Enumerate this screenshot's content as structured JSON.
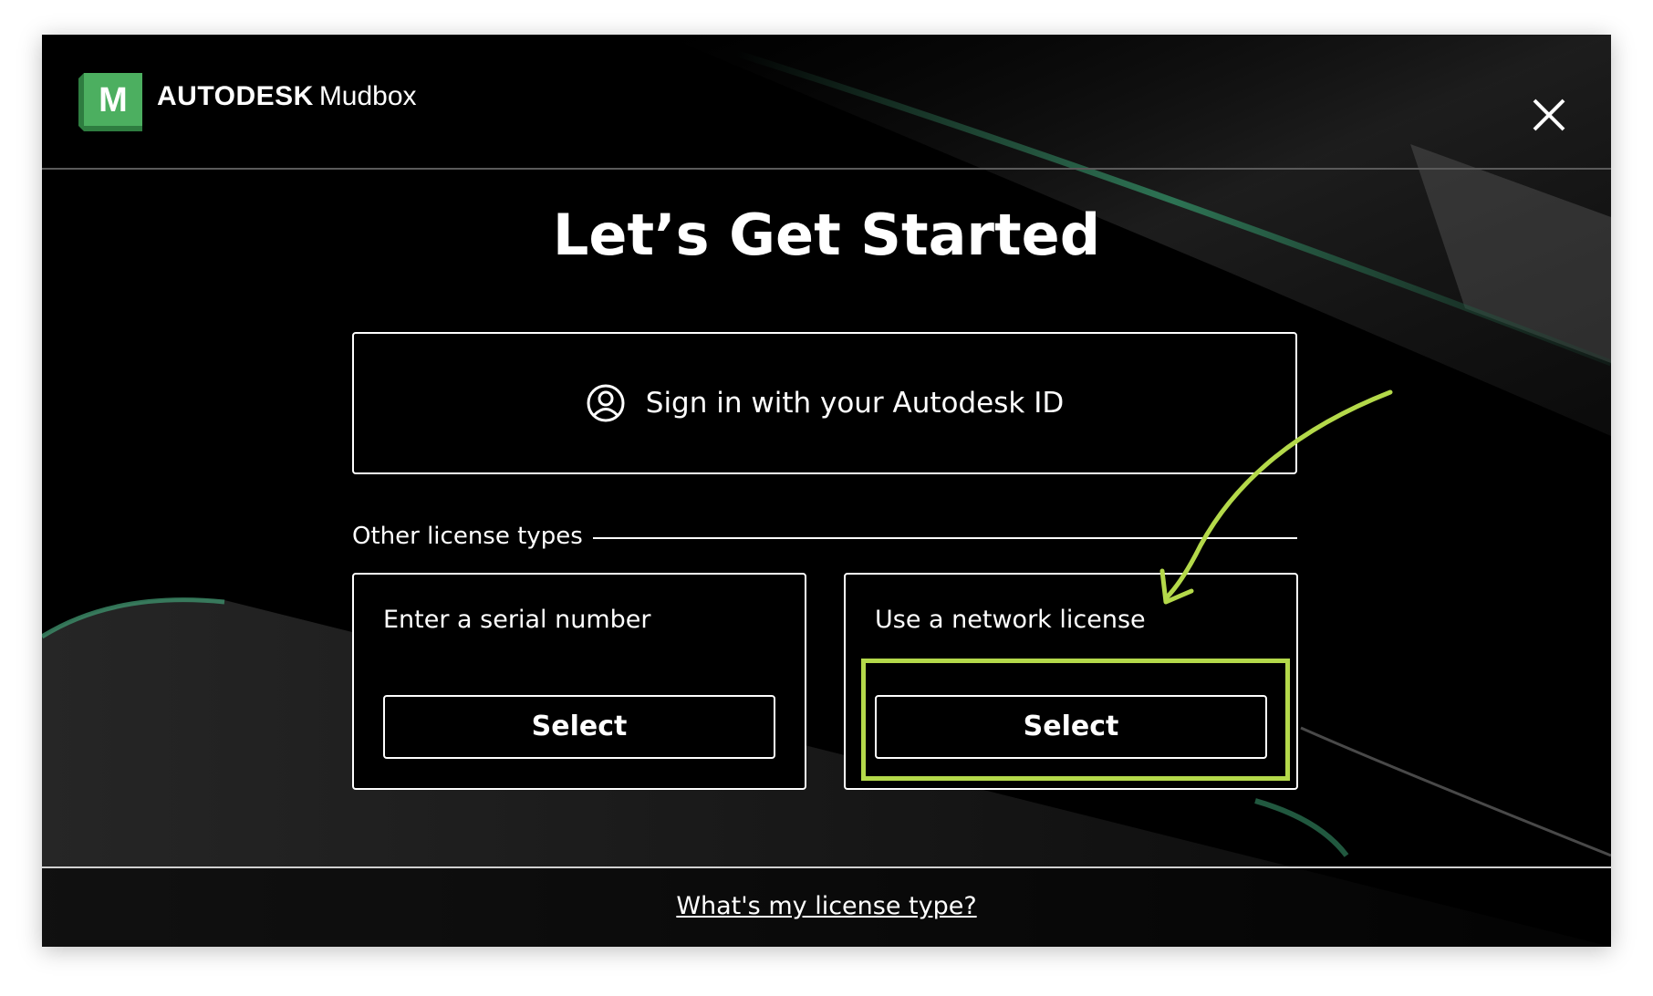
{
  "header": {
    "logo_letter": "M",
    "brand_company": "AUTODESK",
    "brand_product": "Mudbox"
  },
  "main": {
    "title": "Let’s Get Started",
    "signin_label": "Sign in with your Autodesk ID",
    "other_label": "Other license types",
    "cards": [
      {
        "title": "Enter a serial number",
        "button": "Select"
      },
      {
        "title": "Use a network license",
        "button": "Select"
      }
    ]
  },
  "footer": {
    "link": "What's my license type?"
  },
  "colors": {
    "background": "#000000",
    "text": "#ffffff",
    "logo_green": "#3c9b4f",
    "annotation": "#b4d94a"
  },
  "icons": {
    "logo": "mudbox-logo-icon",
    "close": "close-icon",
    "user": "user-circle-icon",
    "annotation": "arrow-annotation-icon"
  }
}
